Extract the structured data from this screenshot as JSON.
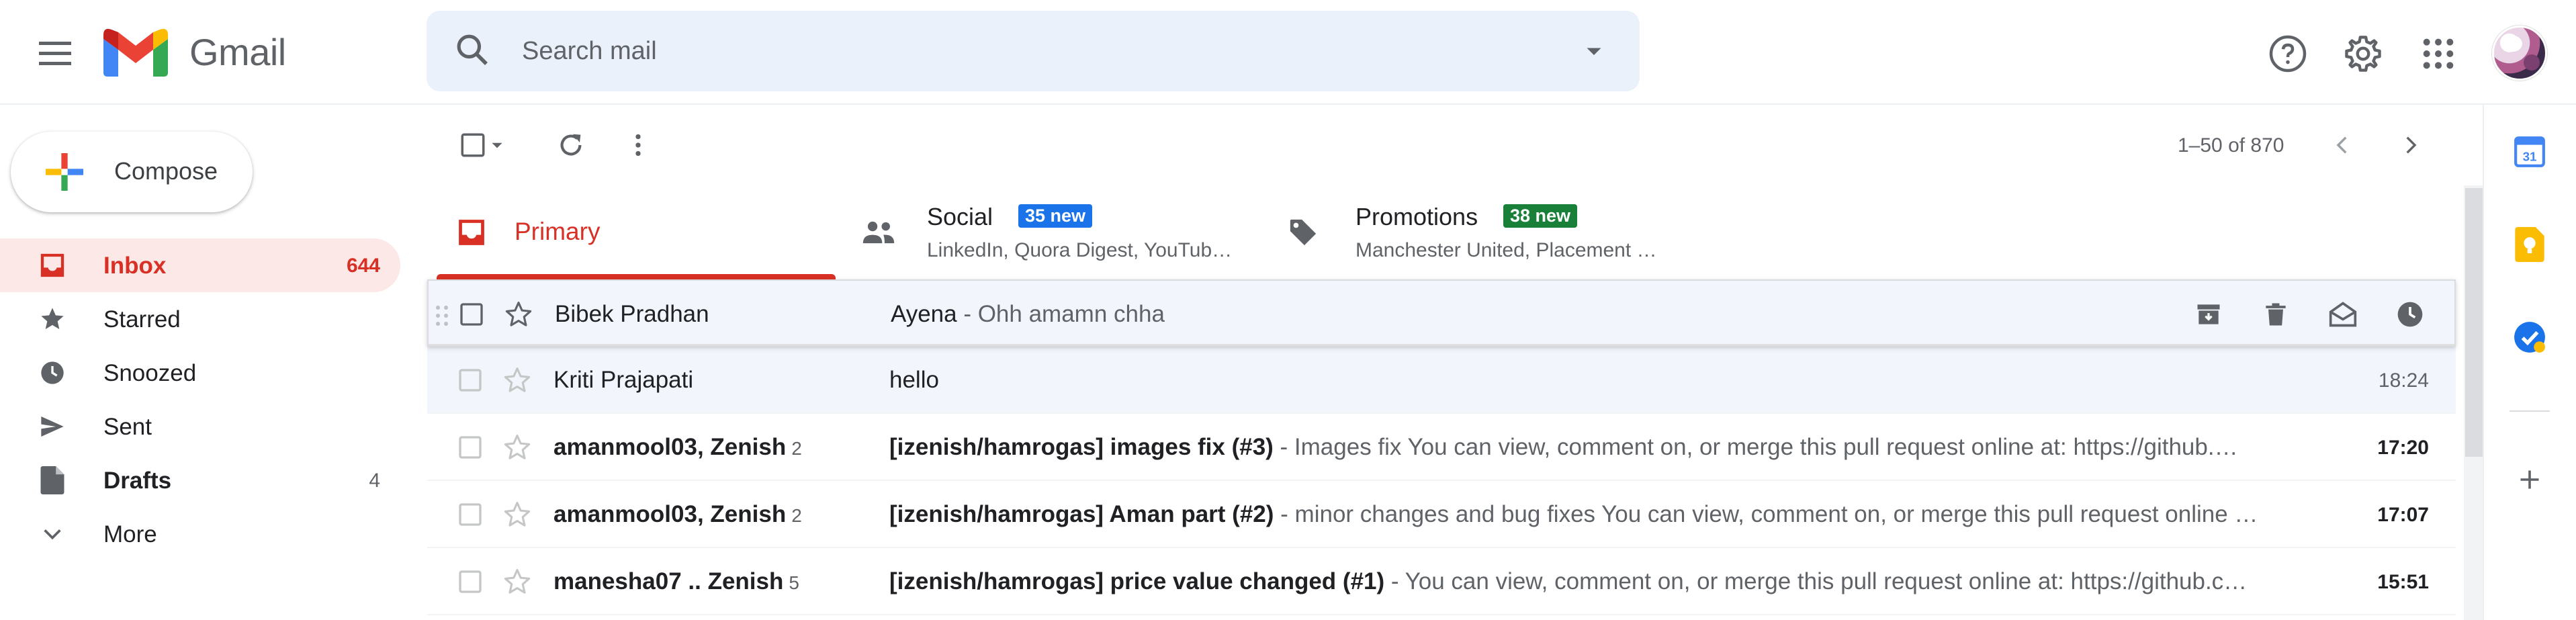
{
  "header": {
    "app_name": "Gmail",
    "search_placeholder": "Search mail",
    "icons": [
      "menu-icon",
      "search-icon",
      "search-options-icon",
      "help-icon",
      "settings-icon",
      "apps-icon",
      "avatar"
    ]
  },
  "compose": {
    "label": "Compose"
  },
  "sidebar": {
    "items": [
      {
        "label": "Inbox",
        "count": "644",
        "icon": "inbox-icon",
        "active": true
      },
      {
        "label": "Starred",
        "count": "",
        "icon": "star-icon"
      },
      {
        "label": "Snoozed",
        "count": "",
        "icon": "clock-icon"
      },
      {
        "label": "Sent",
        "count": "",
        "icon": "send-icon"
      },
      {
        "label": "Drafts",
        "count": "4",
        "icon": "draft-icon"
      },
      {
        "label": "More",
        "count": "",
        "icon": "chevron-down-icon"
      }
    ]
  },
  "toolbar": {
    "pager": "1–50 of 870"
  },
  "tabs": [
    {
      "title": "Primary",
      "active": true
    },
    {
      "title": "Social",
      "badge": "35 new",
      "badge_color": "#1a73e8",
      "subtitle": "LinkedIn, Quora Digest, YouTub…"
    },
    {
      "title": "Promotions",
      "badge": "38 new",
      "badge_color": "#188038",
      "subtitle": "Manchester United, Placement …"
    }
  ],
  "emails": [
    {
      "sender": "Bibek Pradhan",
      "sender_count": "",
      "subject": "Ayena",
      "snippet": " - Ohh amamn chha",
      "time": "",
      "read": true,
      "hover": true
    },
    {
      "sender": "Kriti Prajapati",
      "sender_count": "",
      "subject": "hello",
      "snippet": "",
      "time": "18:24",
      "read": true
    },
    {
      "sender": "amanmool03, Zenish",
      "sender_count": "2",
      "subject": "[izenish/hamrogas] images fix (#3)",
      "snippet": " - Images fix You can view, comment on, or merge this pull request online at: https://github.…",
      "time": "17:20",
      "read": false
    },
    {
      "sender": "amanmool03, Zenish",
      "sender_count": "2",
      "subject": "[izenish/hamrogas] Aman part (#2)",
      "snippet": " - minor changes and bug fixes You can view, comment on, or merge this pull request online …",
      "time": "17:07",
      "read": false
    },
    {
      "sender": "manesha07 .. Zenish",
      "sender_count": "5",
      "subject": "[izenish/hamrogas] price value changed (#1)",
      "snippet": " - You can view, comment on, or merge this pull request online at: https://github.c…",
      "time": "15:51",
      "read": false
    }
  ],
  "side_panel": {
    "icons": [
      "calendar-icon",
      "keep-icon",
      "tasks-icon",
      "add-addon-icon"
    ],
    "calendar_day": "31"
  },
  "colors": {
    "accent_red": "#d93025",
    "active_bg": "#fce8e6",
    "search_bg": "#eaf1fb",
    "social_badge": "#1a73e8",
    "promotions_badge": "#188038"
  }
}
